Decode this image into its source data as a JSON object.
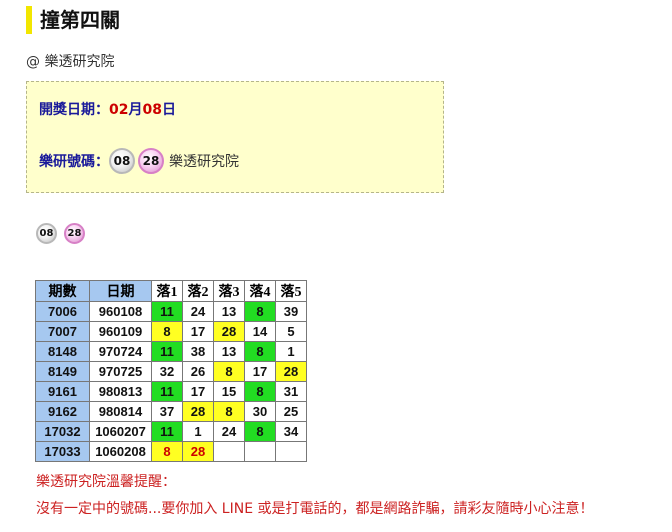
{
  "page": {
    "title": "撞第四關",
    "byline": "@ 樂透研究院"
  },
  "infobox": {
    "date_label": "開獎日期：",
    "date_month": "02",
    "date_month_unit": "月",
    "date_day": "08",
    "date_day_unit": "日",
    "numbers_label": "樂研號碼：",
    "numbers": [
      "08",
      "28"
    ],
    "numbers_suffix": "樂透研究院"
  },
  "loose_balls": [
    "08",
    "28"
  ],
  "table": {
    "headers": [
      "期數",
      "日期",
      "落1",
      "落2",
      "落3",
      "落4",
      "落5"
    ],
    "rows": [
      {
        "period": "7006",
        "date": "960108",
        "cells": [
          "11",
          "24",
          "13",
          "8",
          "39"
        ],
        "highlight": [
          "green",
          "",
          "",
          "green",
          ""
        ]
      },
      {
        "period": "7007",
        "date": "960109",
        "cells": [
          "8",
          "17",
          "28",
          "14",
          "5"
        ],
        "highlight": [
          "yellow",
          "",
          "yellow",
          "",
          ""
        ]
      },
      {
        "period": "8148",
        "date": "970724",
        "cells": [
          "11",
          "38",
          "13",
          "8",
          "1"
        ],
        "highlight": [
          "green",
          "",
          "",
          "green",
          ""
        ]
      },
      {
        "period": "8149",
        "date": "970725",
        "cells": [
          "32",
          "26",
          "8",
          "17",
          "28"
        ],
        "highlight": [
          "",
          "",
          "yellow",
          "",
          "yellow"
        ]
      },
      {
        "period": "9161",
        "date": "980813",
        "cells": [
          "11",
          "17",
          "15",
          "8",
          "31"
        ],
        "highlight": [
          "green",
          "",
          "",
          "green",
          ""
        ]
      },
      {
        "period": "9162",
        "date": "980814",
        "cells": [
          "37",
          "28",
          "8",
          "30",
          "25"
        ],
        "highlight": [
          "",
          "yellow",
          "yellow",
          "",
          ""
        ]
      },
      {
        "period": "17032",
        "date": "1060207",
        "cells": [
          "11",
          "1",
          "24",
          "8",
          "34"
        ],
        "highlight": [
          "green",
          "",
          "",
          "green",
          ""
        ]
      },
      {
        "period": "17033",
        "date": "1060208",
        "cells": [
          "8",
          "28",
          "",
          "",
          ""
        ],
        "highlight": [
          "yellow",
          "yellow",
          "",
          "",
          ""
        ],
        "red_text": true
      }
    ]
  },
  "notice": {
    "title": "樂透研究院溫馨提醒：",
    "text": "沒有一定中的號碼...要你加入 LINE 或是打電話的，都是網路詐騙，請彩友隨時小心注意！"
  },
  "colors": {
    "title_accent": "#f2e600",
    "infobox_bg": "#ffffcc",
    "header_blue": "#a6c8f0",
    "hit_green": "#22dd22",
    "hit_yellow": "#ffff22",
    "warning_red": "#cc2222"
  }
}
